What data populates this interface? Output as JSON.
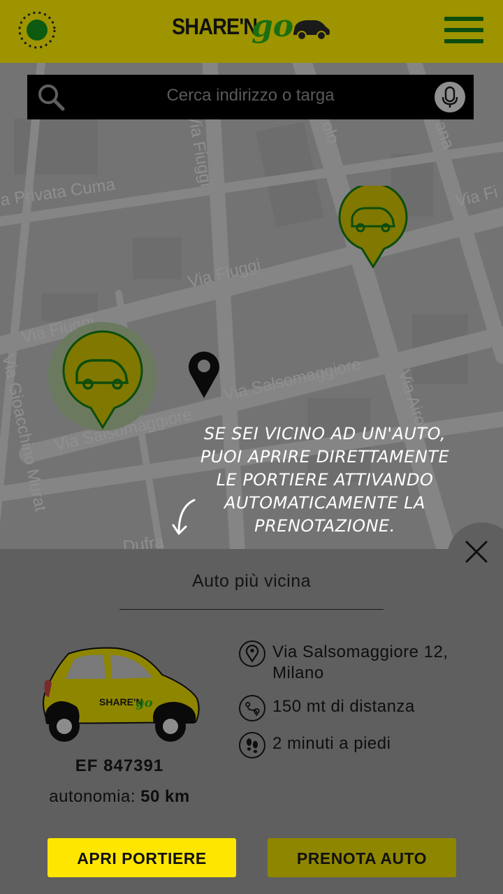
{
  "header": {
    "logo_text": "SHARE'N",
    "logo_text_go": "go"
  },
  "search": {
    "placeholder": "Cerca indirizzo o targa"
  },
  "map": {
    "streets": [
      "a Privata Cuma",
      "Via Fiuggi",
      "Via Fiuggi",
      "Via Fiuggi",
      "Via Salsomaggiore",
      "Via Salsomaggiore",
      "Via Gioacchino Murat",
      "Via Airolo",
      "olo",
      "Via Fi",
      "ana",
      "Dufra"
    ]
  },
  "hint": {
    "line1": "SE SEI VICINO AD UN'AUTO,",
    "line2": "PUOI APRIRE DIRETTAMENTE",
    "line3": "LE PORTIERE ATTIVANDO",
    "line4": "AUTOMATICAMENTE LA",
    "line5": "PRENOTAZIONE."
  },
  "panel": {
    "title": "Auto più vicina",
    "car_logo": "SHARE'N",
    "car_logo_go": "go",
    "plate": "EF 847391",
    "autonomy_label": "autonomia:",
    "autonomy_value": "50 km",
    "address_line1": "Via Salsomaggiore 12,",
    "address_line2": "Milano",
    "distance": "150 mt di distanza",
    "walk_time": "2 minuti a piedi"
  },
  "buttons": {
    "open_doors": "APRI PORTIERE",
    "book_car": "PRENOTA AUTO"
  },
  "colors": {
    "header": "#9d9400",
    "brand_green": "#0d4c0d",
    "brand_yellow": "#ffe600"
  }
}
